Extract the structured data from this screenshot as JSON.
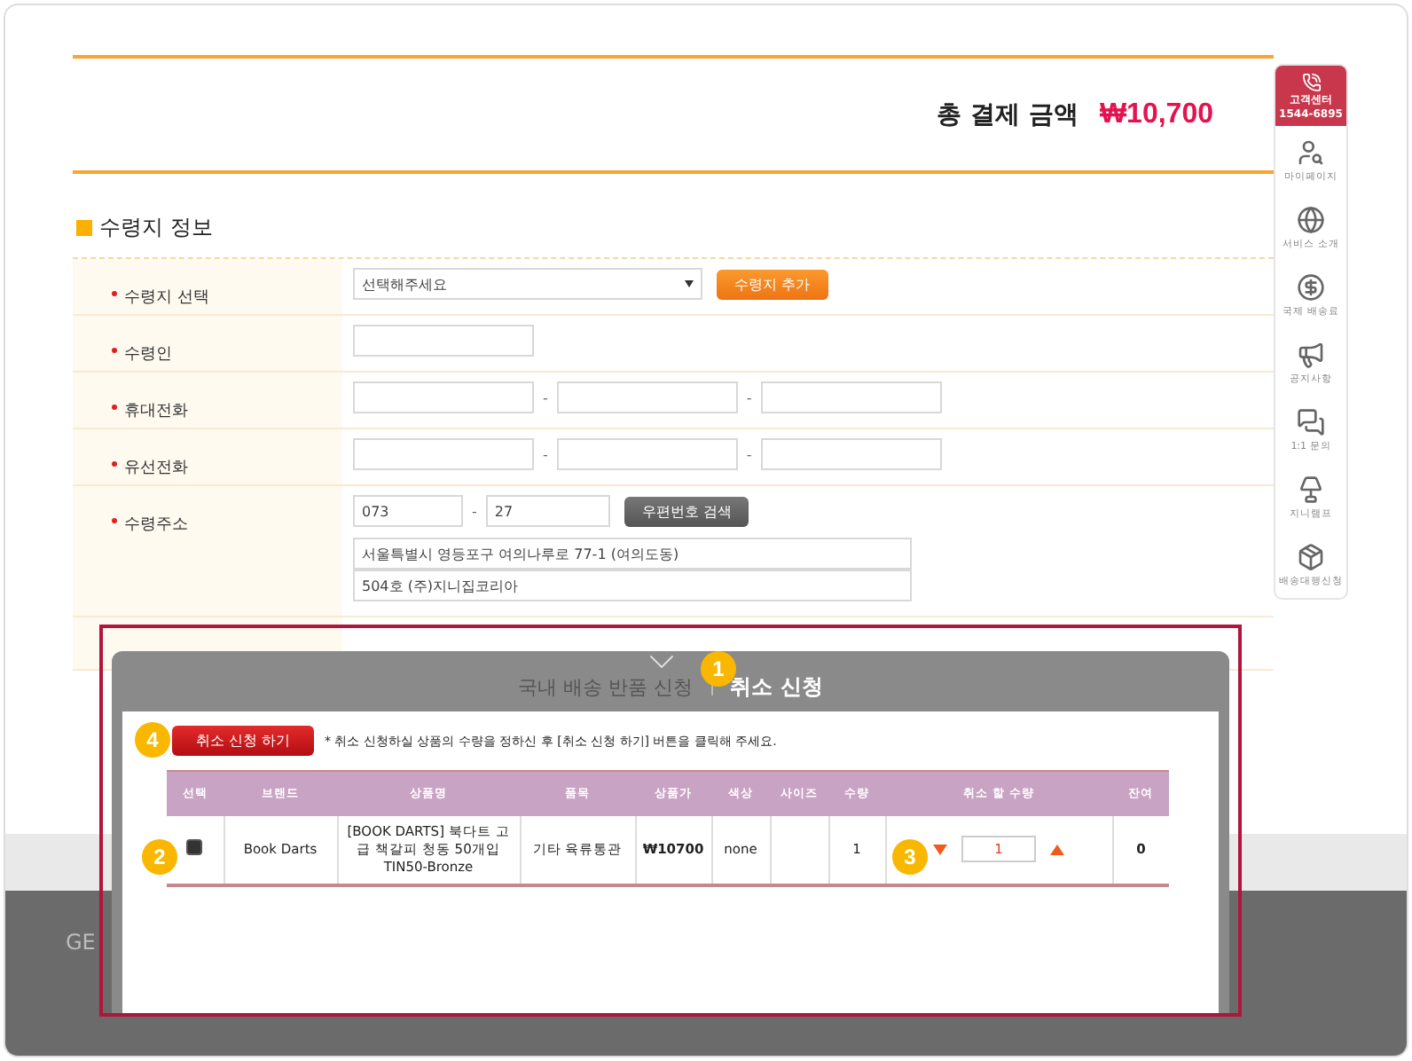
{
  "total": {
    "label": "총 결제 금액",
    "amount": "₩10,700"
  },
  "section_title": "수령지 정보",
  "form_rows": [
    {
      "kind": "select",
      "label": "수령지 선택",
      "value": "선택해주세요",
      "button": "수령지 추가"
    },
    {
      "kind": "text",
      "label": "수령인"
    },
    {
      "kind": "phone",
      "label": "휴대전화",
      "separators": [
        "-",
        "-"
      ]
    },
    {
      "kind": "phone",
      "label": "유선전화",
      "separators": [
        "-",
        "-"
      ]
    },
    {
      "kind": "address",
      "label": "수령주소",
      "separator": "-",
      "zip": [
        "073",
        "27"
      ],
      "button": "우편번호 검색",
      "lines": [
        "서울특별시 영등포구 여의나루로 77-1 (여의도동)",
        "504호 (주)지니집코리아"
      ]
    }
  ],
  "sidebar": {
    "title": "고객센터",
    "number": "1544-6895",
    "items": [
      {
        "label": "마이페이지"
      },
      {
        "label": "서비스 소개"
      },
      {
        "label": "국제 배송료"
      },
      {
        "label": "공지사항"
      },
      {
        "label": "1:1 문의"
      },
      {
        "label": "지니램프"
      },
      {
        "label": "배송대행신청"
      }
    ]
  },
  "footer": {
    "text": "GE"
  },
  "modal": {
    "tabs": [
      {
        "label": "국내 배송 반품 신청",
        "selected": false
      },
      {
        "label": "취소 신청",
        "selected": true
      }
    ],
    "submit": "취소 신청 하기",
    "note": "* 취소 신청하실 상품의 수량을 정하신 후 [취소 신청 하기] 버튼을 클릭해 주세요.",
    "columns": [
      "선택",
      "브랜드",
      "상품명",
      "품목",
      "상품가",
      "색상",
      "사이즈",
      "수량",
      "취소 할 수량",
      "잔여"
    ],
    "rows": [
      {
        "checked": true,
        "brand": "Book Darts",
        "name": "[BOOK DARTS] 북다트 고급 책갈피 청동 50개입 TIN50-Bronze",
        "category": "기타 육류통관",
        "price": "₩10700",
        "variant": "none",
        "qty": "1",
        "cancel_qty": "1",
        "remaining": "0"
      }
    ],
    "callouts": [
      "1",
      "2",
      "3",
      "4"
    ]
  }
}
